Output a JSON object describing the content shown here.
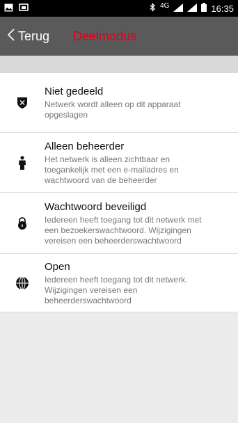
{
  "status_bar": {
    "network": "4G",
    "time": "16:35",
    "icons": [
      "image-icon",
      "cast-icon",
      "bluetooth-icon",
      "signal-icon",
      "battery-icon"
    ]
  },
  "header": {
    "back_label": "Terug",
    "title": "Deelmodus",
    "title_color": "#e0001b"
  },
  "options": [
    {
      "icon": "shield-x-icon",
      "title": "Niet gedeeld",
      "description": "Netwerk wordt alleen op dit apparaat opgeslagen"
    },
    {
      "icon": "person-icon",
      "title": "Alleen beheerder",
      "description": "Het netwerk is alleen zichtbaar en toegankelijk met een e-mailadres en wachtwoord van de beheerder"
    },
    {
      "icon": "lock-icon",
      "title": "Wachtwoord beveiligd",
      "description": "Iedereen heeft toegang tot dit netwerk met een bezoekerswachtwoord. Wijzigingen vereisen een beheerderswachtwoord"
    },
    {
      "icon": "globe-icon",
      "title": "Open",
      "description": "Iedereen heeft toegang tot dit netwerk. Wijzigingen vereisen een beheerderswachtwoord"
    }
  ]
}
